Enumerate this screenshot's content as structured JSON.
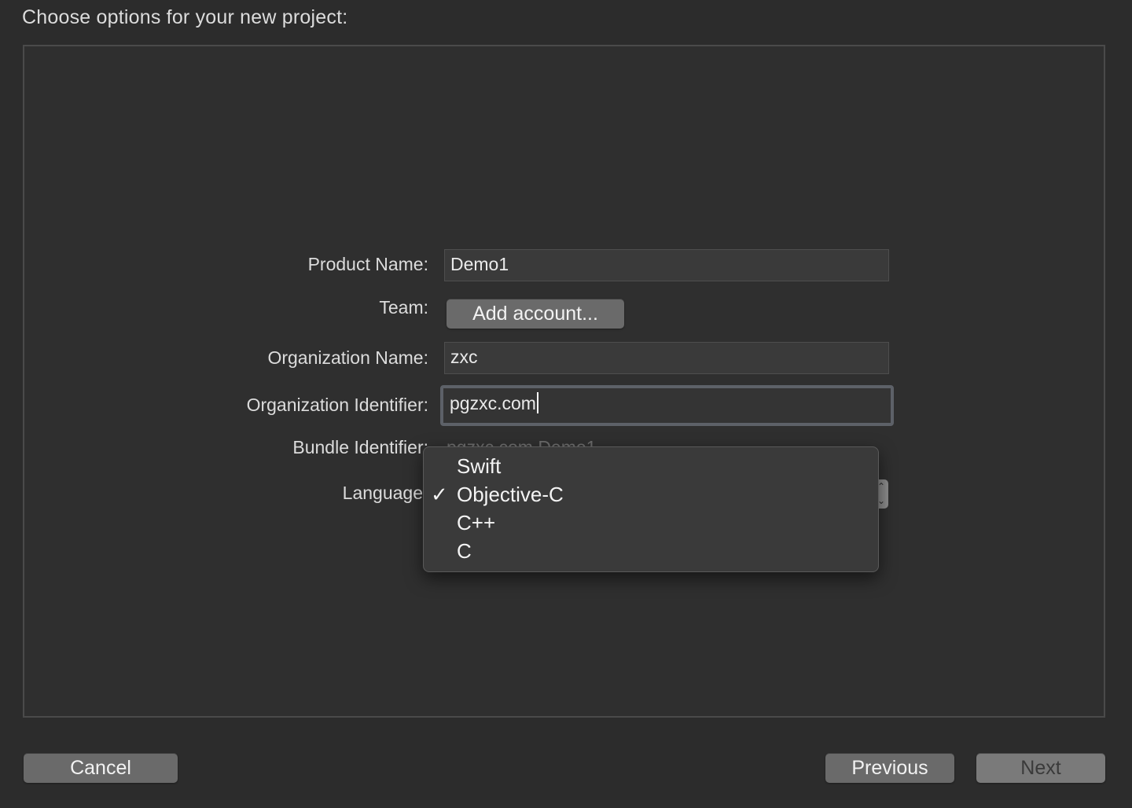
{
  "heading": "Choose options for your new project:",
  "form": {
    "product_name_label": "Product Name:",
    "product_name_value": "Demo1",
    "team_label": "Team:",
    "team_button": "Add account...",
    "org_name_label": "Organization Name:",
    "org_name_value": "zxc",
    "org_id_label": "Organization Identifier:",
    "org_id_value": "pgzxc.com",
    "bundle_id_label": "Bundle Identifier:",
    "bundle_id_value": "pgzxc.com.Demo1",
    "language_label": "Language"
  },
  "language_menu": {
    "selected": "Objective-C",
    "check_glyph": "✓",
    "options": [
      "Swift",
      "Objective-C",
      "C++",
      "C"
    ]
  },
  "footer": {
    "cancel": "Cancel",
    "previous": "Previous",
    "next": "Next"
  }
}
